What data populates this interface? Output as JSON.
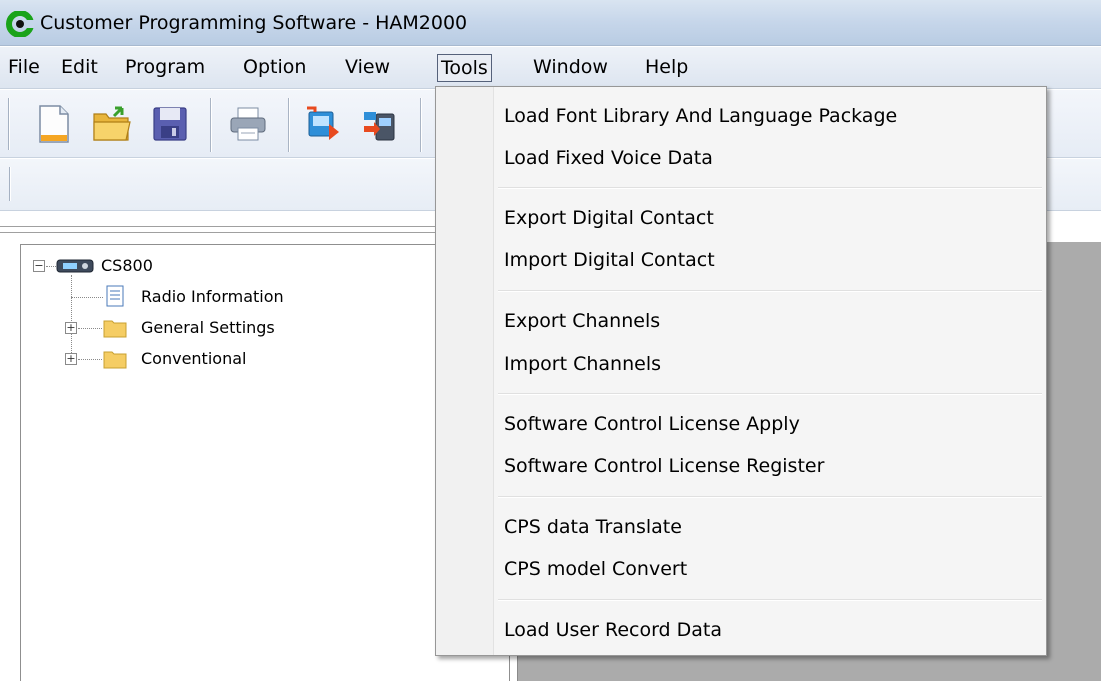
{
  "window": {
    "title": "Customer Programming Software - HAM2000"
  },
  "menubar": {
    "items": [
      "File",
      "Edit",
      "Program",
      "Option",
      "View",
      "Tools",
      "Window",
      "Help"
    ],
    "active": "Tools"
  },
  "toolbar": {
    "buttons": [
      "new-file-icon",
      "open-folder-icon",
      "save-icon",
      "print-icon",
      "read-from-radio-icon",
      "write-to-radio-icon"
    ]
  },
  "tree": {
    "root": "CS800",
    "children": [
      "Radio Information",
      "General Settings",
      "Conventional"
    ]
  },
  "tools_menu": {
    "items": [
      "Load Font Library And Language Package",
      "Load Fixed Voice Data",
      "Export Digital Contact",
      "Import Digital Contact",
      "Export Channels",
      "Import Channels",
      "Software Control License Apply",
      "Software Control License Register",
      "CPS data Translate",
      "CPS model Convert",
      "Load User Record Data"
    ]
  },
  "colors": {
    "title_bar": "#c6d6ea",
    "menu_bar": "#dde5f0",
    "mdi_background": "#ababab",
    "menu_background": "#f5f5f5"
  }
}
